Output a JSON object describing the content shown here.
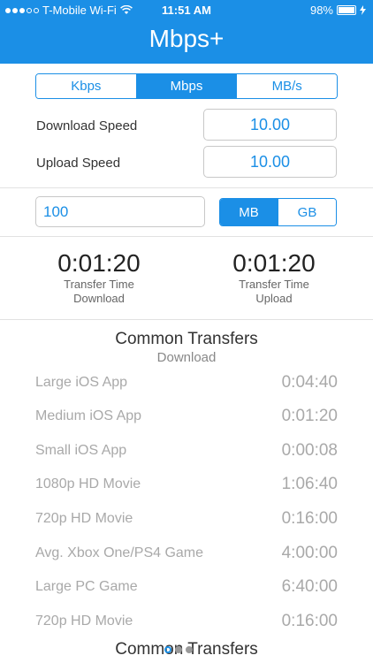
{
  "status_bar": {
    "carrier": "T-Mobile Wi-Fi",
    "time": "11:51 AM",
    "battery": "98%",
    "battery_level": 0.98,
    "signal_filled": 3,
    "signal_total": 5
  },
  "header": {
    "title": "Mbps+"
  },
  "units": {
    "options": [
      "Kbps",
      "Mbps",
      "MB/s"
    ],
    "selected": "Mbps"
  },
  "speeds": {
    "download_label": "Download Speed",
    "download_value": "10.00",
    "upload_label": "Upload Speed",
    "upload_value": "10.00"
  },
  "size": {
    "value": "100",
    "units": [
      "MB",
      "GB"
    ],
    "selected": "MB"
  },
  "transfer": {
    "download_time": "0:01:20",
    "upload_time": "0:01:20",
    "label": "Transfer Time",
    "download_label": "Download",
    "upload_label": "Upload"
  },
  "common": {
    "title": "Common Transfers",
    "subtitle": "Download",
    "items": [
      {
        "name": "Large iOS App",
        "time": "0:04:40"
      },
      {
        "name": "Medium iOS App",
        "time": "0:01:20"
      },
      {
        "name": "Small iOS App",
        "time": "0:00:08"
      },
      {
        "name": "1080p HD Movie",
        "time": "1:06:40"
      },
      {
        "name": "720p HD Movie",
        "time": "0:16:00"
      },
      {
        "name": "Avg. Xbox One/PS4 Game",
        "time": "4:00:00"
      },
      {
        "name": "Large PC Game",
        "time": "6:40:00"
      },
      {
        "name": "720p HD Movie",
        "time": "0:16:00"
      }
    ],
    "next_title": "Common Transfers"
  },
  "colors": {
    "accent": "#1b8fe6",
    "muted_text": "#a9a9a9"
  }
}
